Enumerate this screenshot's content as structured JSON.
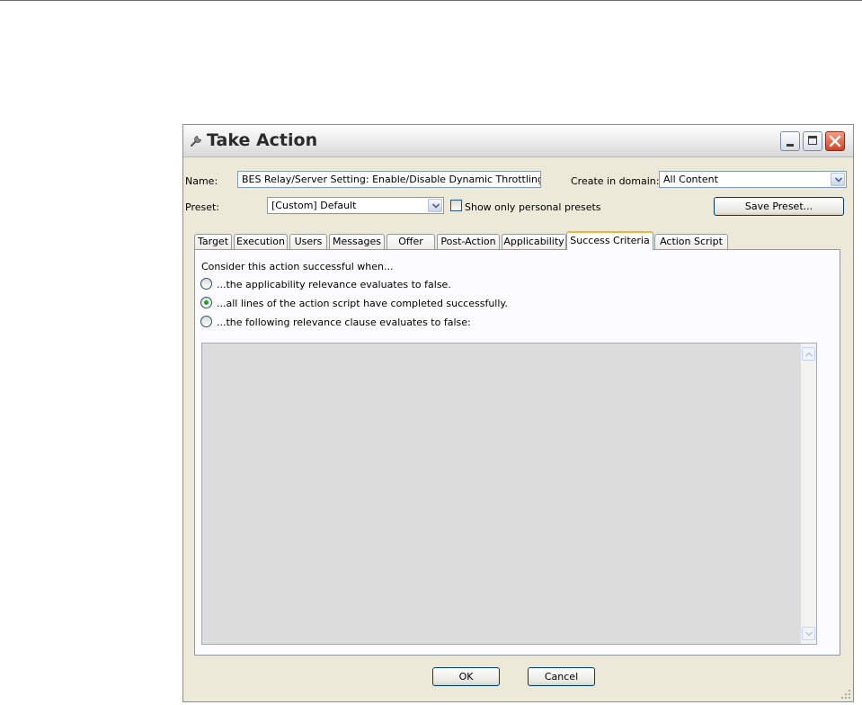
{
  "window": {
    "title": "Take Action"
  },
  "form": {
    "name_label": "Name:",
    "name_value": "BES Relay/Server Setting: Enable/Disable Dynamic Throttling",
    "domain_label": "Create in domain:",
    "domain_value": "All Content",
    "preset_label": "Preset:",
    "preset_value": "[Custom] Default",
    "personal_presets_label": "Show only personal presets",
    "personal_presets_checked": false,
    "save_preset_label": "Save Preset..."
  },
  "tabs": [
    {
      "label": "Target"
    },
    {
      "label": "Execution"
    },
    {
      "label": "Users"
    },
    {
      "label": "Messages"
    },
    {
      "label": "Offer"
    },
    {
      "label": "Post-Action"
    },
    {
      "label": "Applicability"
    },
    {
      "label": "Success Criteria",
      "active": true
    },
    {
      "label": "Action Script"
    }
  ],
  "success": {
    "intro": "Consider this action successful when...",
    "options": [
      {
        "label": "...the applicability relevance evaluates to false.",
        "selected": false
      },
      {
        "label": "...all lines of the action script have completed successfully.",
        "selected": true
      },
      {
        "label": "...the following relevance clause evaluates to false:",
        "selected": false
      }
    ],
    "clause_value": ""
  },
  "buttons": {
    "ok": "OK",
    "cancel": "Cancel"
  },
  "icons": {
    "title": "wrench-icon",
    "minimize": "minimize-icon",
    "maximize": "maximize-icon",
    "close": "close-icon",
    "dropdown": "chevron-down-icon",
    "scroll_up": "scroll-up-arrow-icon",
    "scroll_down": "scroll-down-arrow-icon",
    "resize": "resize-grip-icon"
  },
  "colors": {
    "dialog_bg": "#ece9d8",
    "active_tab_accent": "#f0b43c",
    "radio_selected": "#21a121",
    "close_button": "#d24321"
  }
}
